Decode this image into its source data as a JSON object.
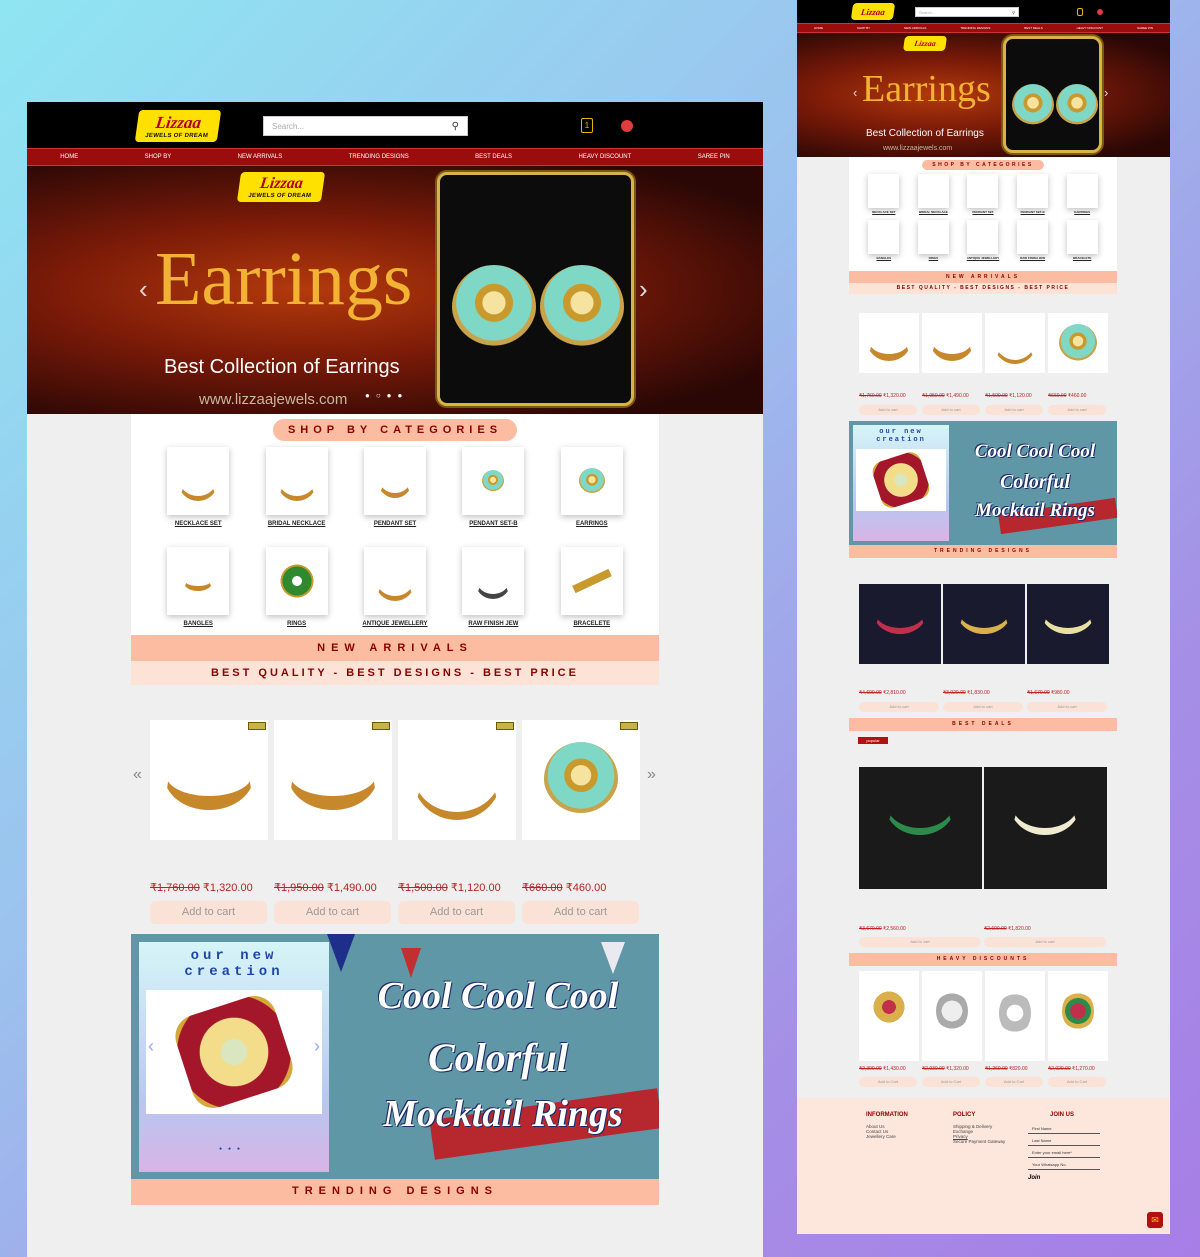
{
  "brand": {
    "name": "Lizzaa",
    "tagline": "JEWELS OF DREAM"
  },
  "search": {
    "placeholder": "Search..."
  },
  "cart": {
    "count": "1"
  },
  "nav": [
    "HOME",
    "SHOP BY",
    "NEW ARRIVALS",
    "TRENDING DESIGNS",
    "BEST DEALS",
    "HEAVY DISCOUNT",
    "SAREE PIN"
  ],
  "hero": {
    "title": "Earrings",
    "subtitle": "Best Collection of Earrings",
    "url": "www.lizzaajewels.com"
  },
  "categories": {
    "heading": "SHOP BY CATEGORIES",
    "items": [
      "NECKLACE SET",
      "BRIDAL NECKLACE",
      "PENDANT SET",
      "PENDANT SET-B",
      "EARRINGS",
      "BANGLES",
      "RINGS",
      "ANTIQUE JEWELLERY",
      "RAW FINISH JEW",
      "BRACELETE"
    ]
  },
  "new_arrivals": {
    "heading": "NEW ARRIVALS",
    "tagline": "BEST QUALITY - BEST DESIGNS - BEST PRICE",
    "products": [
      {
        "old": "₹1,760.00",
        "new": "₹1,320.00",
        "button": "Add to cart"
      },
      {
        "old": "₹1,950.00",
        "new": "₹1,490.00",
        "button": "Add to cart"
      },
      {
        "old": "₹1,500.00",
        "new": "₹1,120.00",
        "button": "Add to cart"
      },
      {
        "old": "₹660.00",
        "new": "₹460.00",
        "button": "Add to cart"
      }
    ]
  },
  "promo": {
    "card_title_1": "our new",
    "card_title_2": "creation",
    "line1": "Cool Cool Cool",
    "line2": "Colorful",
    "line3": "Mocktail Rings"
  },
  "trending": {
    "heading": "TRENDING DESIGNS",
    "products": [
      {
        "old": "₹4,690.00",
        "new": "₹2,810.00",
        "button": "Add to cart"
      },
      {
        "old": "₹3,020.00",
        "new": "₹1,830.00",
        "button": "Add to cart"
      },
      {
        "old": "₹1,670.00",
        "new": "₹980.00",
        "button": "Add to cart"
      }
    ]
  },
  "best_deals": {
    "heading": "BEST DEALS",
    "tag": "popular",
    "products": [
      {
        "old": "₹3,670.00",
        "new": "₹2,560.00",
        "button": "Add to cart"
      },
      {
        "old": "₹2,600.00",
        "new": "₹1,820.00",
        "button": "Add to cart"
      }
    ]
  },
  "heavy_discounts": {
    "heading": "HEAVY DISCOUNTS",
    "products": [
      {
        "old": "₹2,390.00",
        "new": "₹1,430.00",
        "button": "Add to Cart"
      },
      {
        "old": "₹2,930.00",
        "new": "₹1,320.00",
        "button": "Add to Cart"
      },
      {
        "old": "₹1,260.00",
        "new": "₹820.00",
        "button": "Add to Cart"
      },
      {
        "old": "₹2,020.00",
        "new": "₹1,270.00",
        "button": "Add to Cart"
      }
    ]
  },
  "footer": {
    "info": {
      "title": "INFORMATION",
      "links": [
        "About Us",
        "Contact Us",
        "Jewellery Care"
      ]
    },
    "policy": {
      "title": "POLICY",
      "links": [
        "Shipping & Delivery",
        "Exchange",
        "Privacy",
        "Secure Payment Gateway"
      ]
    },
    "join": {
      "title": "JOIN US",
      "fields": [
        "First Name",
        "Last Name",
        "Enter your email here*",
        "Your Whatsapp No."
      ],
      "button": "Join"
    }
  },
  "colors": {
    "nav": "#9b0d0d",
    "accent": "#fbbca2",
    "price": "#b22222"
  }
}
